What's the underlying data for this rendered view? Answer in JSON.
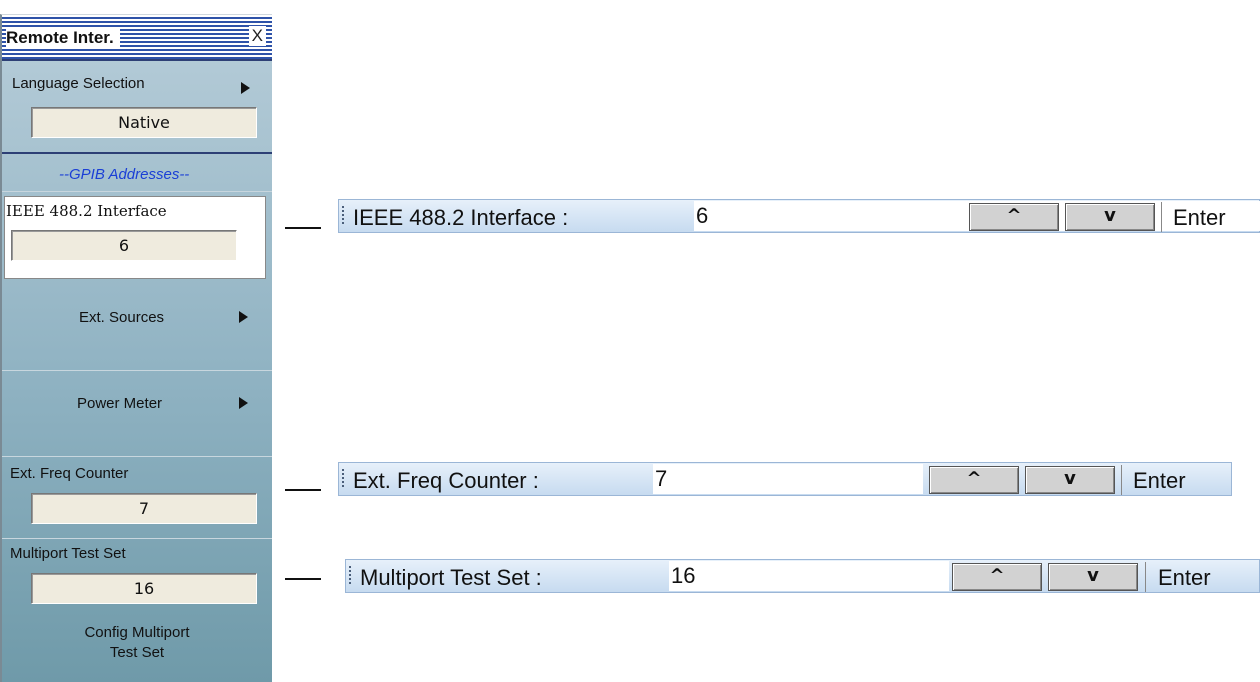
{
  "panel": {
    "title": "Remote Inter.",
    "close": "X",
    "language_selection": {
      "label": "Language Selection",
      "value": "Native"
    },
    "gpib_header": "--GPIB Addresses--",
    "ieee_interface": {
      "label": "IEEE 488.2 Interface",
      "value": "6"
    },
    "ext_sources": {
      "label": "Ext. Sources"
    },
    "power_meter": {
      "label": "Power Meter"
    },
    "ext_freq_counter": {
      "label": "Ext. Freq Counter",
      "value": "7"
    },
    "multiport_test_set": {
      "label": "Multiport Test Set",
      "value": "16"
    },
    "config_multiport": {
      "line1": "Config Multiport",
      "line2": "Test Set"
    }
  },
  "dialogs": [
    {
      "label": "IEEE 488.2 Interface :",
      "value": "6",
      "up": "^",
      "down": "v",
      "enter": "Enter"
    },
    {
      "label": "Ext. Freq Counter :",
      "value": "7",
      "up": "^",
      "down": "v",
      "enter": "Enter"
    },
    {
      "label": "Multiport Test Set :",
      "value": "16",
      "up": "^",
      "down": "v",
      "enter": "Enter"
    }
  ],
  "icons": {
    "submenu_arrow": "right-triangle-icon",
    "up_arrow": "caret-up-icon",
    "down_arrow": "caret-down-icon"
  },
  "colors": {
    "highlight_title": "#2e52a8",
    "gpib_header_text": "#1a3fd6",
    "value_box": "#efebde"
  }
}
